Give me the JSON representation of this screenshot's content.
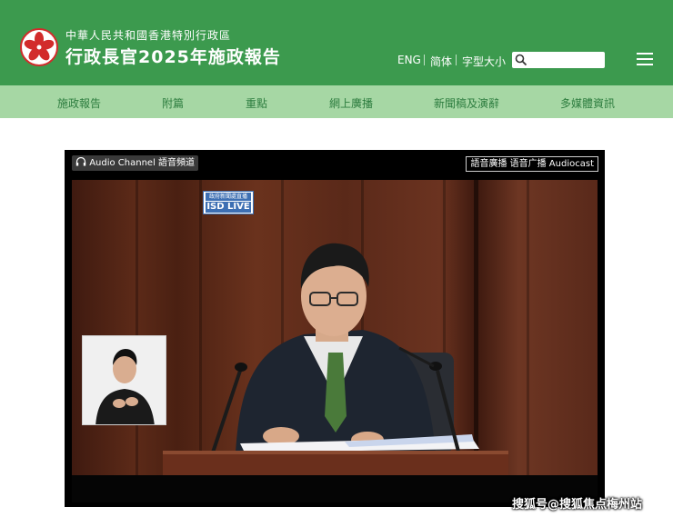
{
  "header": {
    "subtitle": "中華人民共和國香港特別行政區",
    "title": "行政長官2025年施政報告",
    "lang_eng": "ENG",
    "lang_simplified": "简体",
    "font_size": "字型大小",
    "search_placeholder": "",
    "background_color": "#3c9a4e"
  },
  "nav": {
    "items": [
      {
        "label": "施政報告"
      },
      {
        "label": "附篇"
      },
      {
        "label": "重點"
      },
      {
        "label": "網上廣播"
      },
      {
        "label": "新聞稿及演辭"
      },
      {
        "label": "多媒體資訊"
      }
    ],
    "background_color": "#a6d7a4",
    "text_color": "#2d7d3f"
  },
  "video": {
    "audio_channel_label": "Audio Channel 語音頻道",
    "audiocast_label": "語音廣播 语音广播 Audiocast",
    "isd_logo_top": "政府新聞處直播",
    "isd_logo_text": "ISD LIVE"
  },
  "watermark": "搜狐号@搜狐焦点梅州站",
  "icons": [
    "bauhinia-emblem-icon",
    "search-icon",
    "hamburger-menu-icon",
    "headphones-icon"
  ]
}
